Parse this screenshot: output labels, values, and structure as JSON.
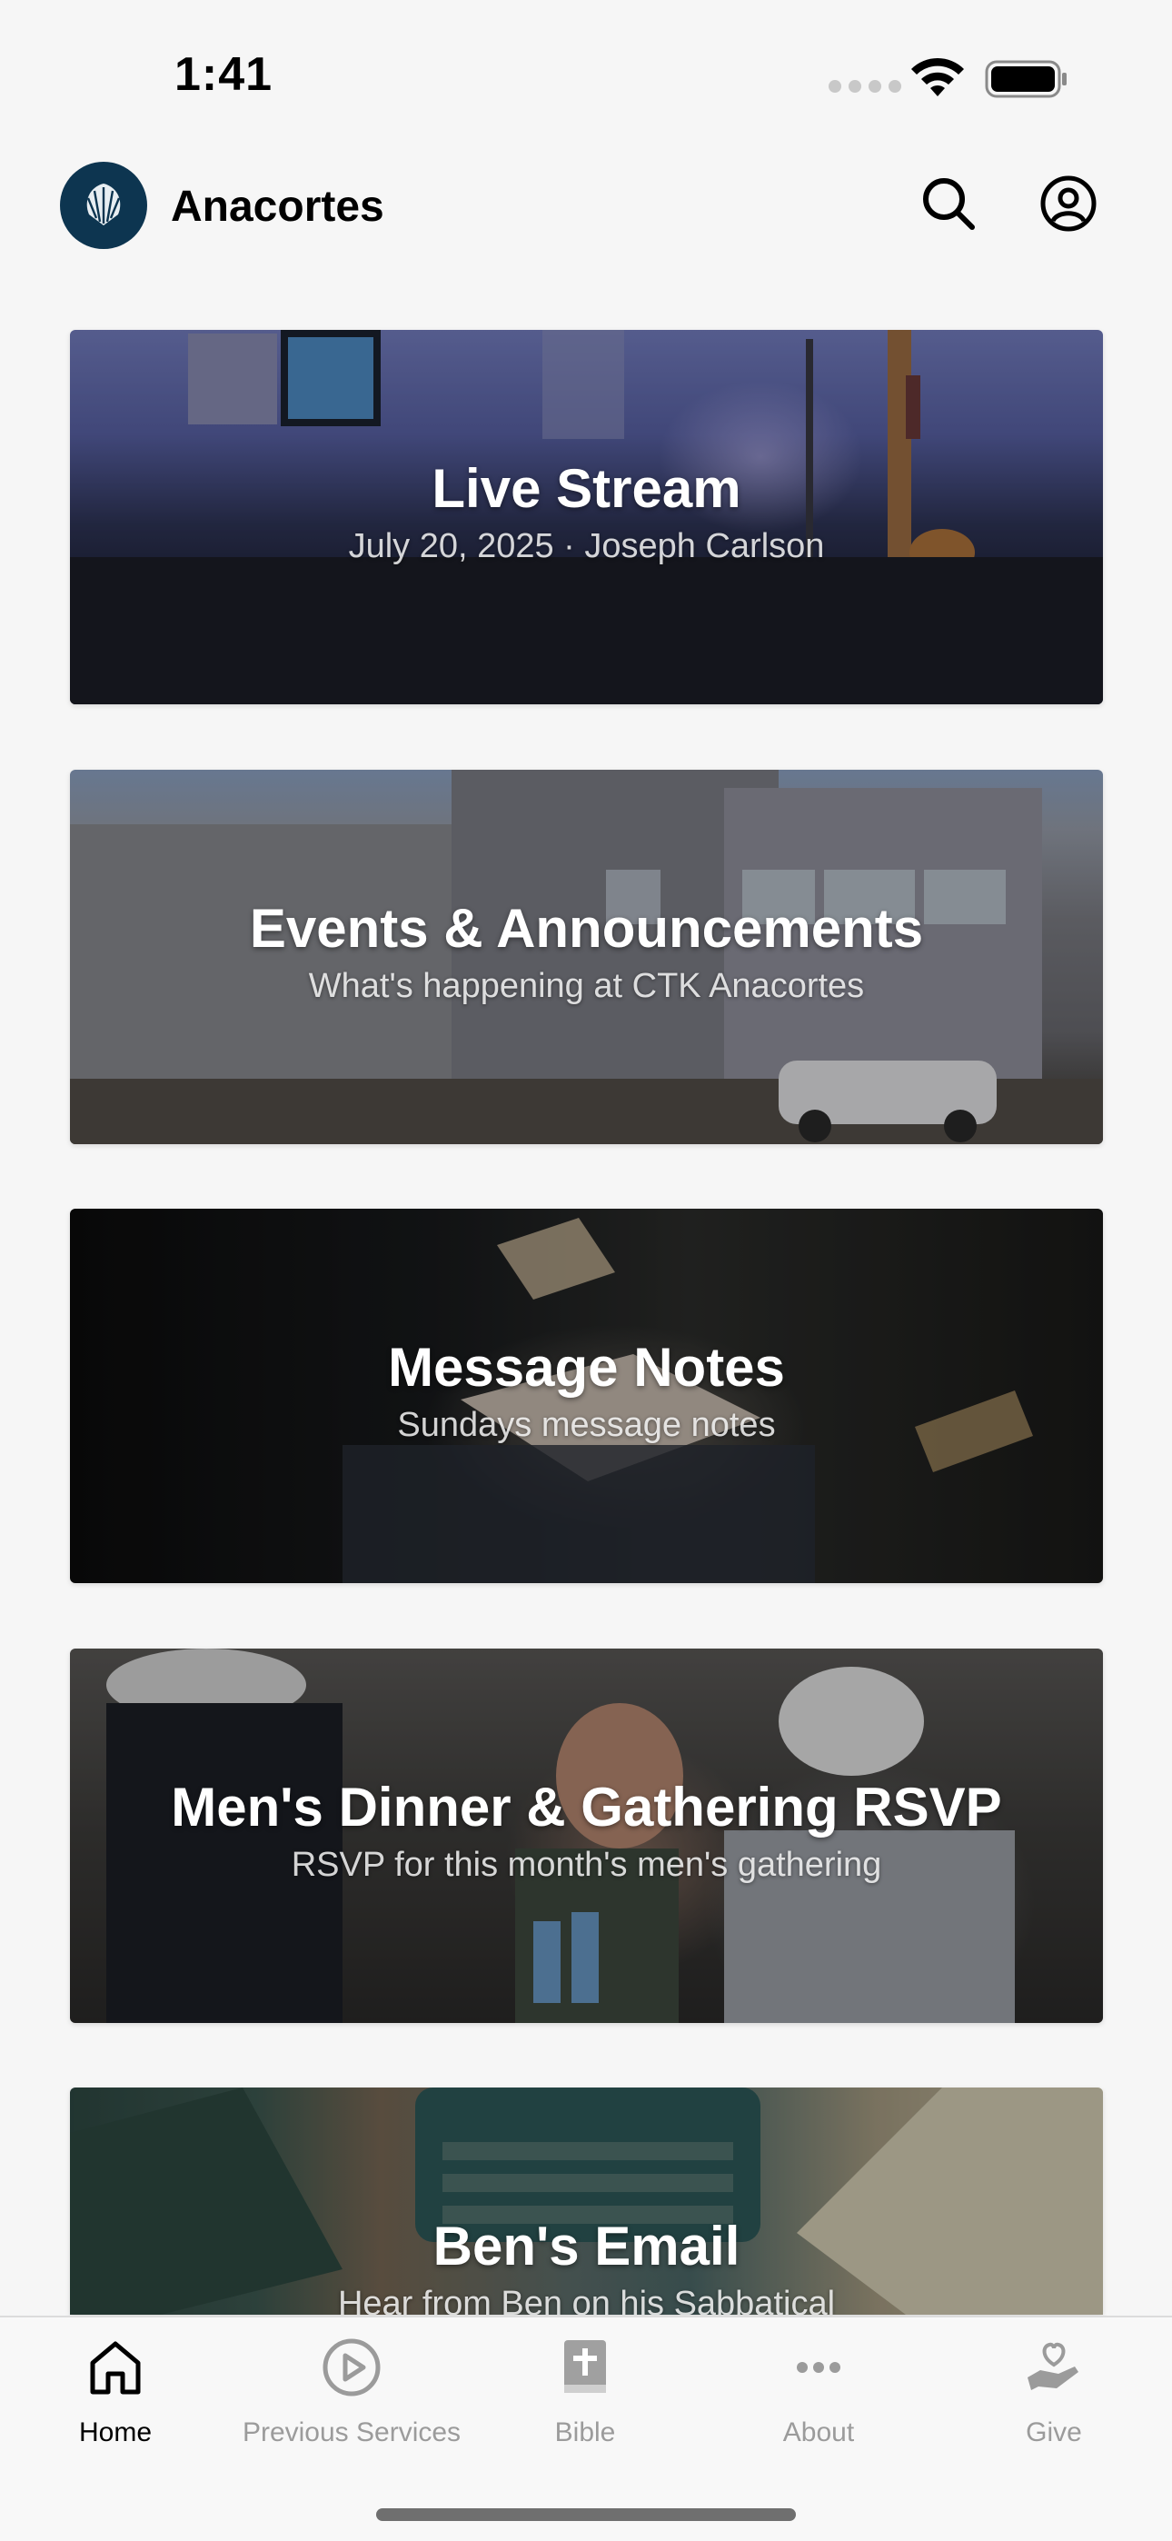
{
  "status_bar": {
    "time": "1:41"
  },
  "header": {
    "app_name": "Anacortes",
    "logo_icon": "church-shell-logo",
    "search_icon": "search-icon",
    "account_icon": "account-icon"
  },
  "cards": [
    {
      "title": "Live Stream",
      "subtitle": "July 20, 2025 · Joseph Carlson"
    },
    {
      "title": "Events & Announcements",
      "subtitle": "What's happening at CTK Anacortes"
    },
    {
      "title": "Message Notes",
      "subtitle": "Sundays message notes"
    },
    {
      "title": "Men's Dinner & Gathering RSVP",
      "subtitle": "RSVP for this month's men's gathering"
    },
    {
      "title": "Ben's Email",
      "subtitle": "Hear from Ben on his Sabbatical"
    }
  ],
  "tab_bar": {
    "tabs": [
      {
        "label": "Home",
        "icon": "home-icon",
        "active": true
      },
      {
        "label": "Previous Services",
        "icon": "play-circle-icon",
        "active": false
      },
      {
        "label": "Bible",
        "icon": "bible-icon",
        "active": false
      },
      {
        "label": "About",
        "icon": "more-icon",
        "active": false
      },
      {
        "label": "Give",
        "icon": "give-hand-heart-icon",
        "active": false
      }
    ]
  },
  "colors": {
    "logo_background": "#0d3550",
    "active_tab": "#000000",
    "inactive_tab": "#9b9b9b",
    "page_background": "#f6f6f6"
  }
}
